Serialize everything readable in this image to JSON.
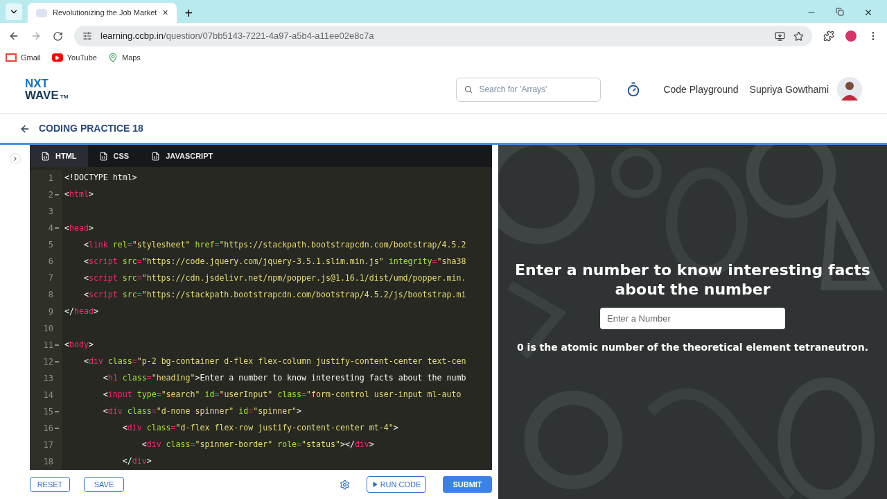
{
  "browser": {
    "tab": {
      "title": "Revolutionizing the Job Market",
      "close": "×"
    },
    "new_tab": "+",
    "url_host": "learning.ccbp.in",
    "url_path": "/question/07bb5143-7221-4a97-a5b4-a11ee02e8c7a",
    "bookmarks": [
      "Gmail",
      "YouTube",
      "Maps"
    ]
  },
  "header": {
    "logo_top": "NXT",
    "logo_bottom": "WAVE",
    "logo_tm": "TM",
    "search": {
      "placeholder": "Search for 'Arrays'"
    },
    "playground": "Code Playground",
    "user": "Supriya Gowthami"
  },
  "practice": {
    "title": "CODING PRACTICE 18"
  },
  "editor": {
    "tabs": [
      {
        "label": "HTML",
        "selected": true
      },
      {
        "label": "CSS",
        "selected": false
      },
      {
        "label": "JAVASCRIPT",
        "selected": false
      }
    ],
    "lines": [
      {
        "number": "1",
        "foldable": false,
        "tokens": [
          {
            "kind": "text",
            "text": "<!DOCTYPE html>"
          }
        ]
      },
      {
        "number": "2",
        "foldable": true,
        "tokens": [
          {
            "kind": "punct",
            "text": "<"
          },
          {
            "kind": "tag",
            "text": "html"
          },
          {
            "kind": "punct",
            "text": ">"
          }
        ]
      },
      {
        "number": "3",
        "foldable": false
      },
      {
        "number": "4",
        "foldable": true,
        "tokens": [
          {
            "kind": "punct",
            "text": "<"
          },
          {
            "kind": "tag",
            "text": "head"
          },
          {
            "kind": "punct",
            "text": ">"
          }
        ]
      },
      {
        "number": "5",
        "foldable": false,
        "tokens": [
          {
            "kind": "punct",
            "text": "    <"
          },
          {
            "kind": "tag",
            "text": "link"
          },
          {
            "kind": "attr",
            "text": " rel"
          },
          {
            "kind": "eq",
            "text": "="
          },
          {
            "kind": "string",
            "text": "\"stylesheet\""
          },
          {
            "kind": "attr",
            "text": " href"
          },
          {
            "kind": "eq",
            "text": "="
          },
          {
            "kind": "string",
            "text": "\"https://stackpath.bootstrapcdn.com/bootstrap/4.5.2"
          }
        ]
      },
      {
        "number": "6",
        "foldable": false,
        "tokens": [
          {
            "kind": "punct",
            "text": "    <"
          },
          {
            "kind": "tag",
            "text": "script"
          },
          {
            "kind": "attr",
            "text": " src"
          },
          {
            "kind": "eq",
            "text": "="
          },
          {
            "kind": "string",
            "text": "\"https://code.jquery.com/jquery-3.5.1.slim.min.js\""
          },
          {
            "kind": "attr",
            "text": " integrity"
          },
          {
            "kind": "eq",
            "text": "="
          },
          {
            "kind": "string",
            "text": "\"sha38"
          }
        ]
      },
      {
        "number": "7",
        "foldable": false,
        "tokens": [
          {
            "kind": "punct",
            "text": "    <"
          },
          {
            "kind": "tag",
            "text": "script"
          },
          {
            "kind": "attr",
            "text": " src"
          },
          {
            "kind": "eq",
            "text": "="
          },
          {
            "kind": "string",
            "text": "\"https://cdn.jsdelivr.net/npm/popper.js@1.16.1/dist/umd/popper.min."
          }
        ]
      },
      {
        "number": "8",
        "foldable": false,
        "tokens": [
          {
            "kind": "punct",
            "text": "    <"
          },
          {
            "kind": "tag",
            "text": "script"
          },
          {
            "kind": "attr",
            "text": " src"
          },
          {
            "kind": "eq",
            "text": "="
          },
          {
            "kind": "string",
            "text": "\"https://stackpath.bootstrapcdn.com/bootstrap/4.5.2/js/bootstrap.mi"
          }
        ]
      },
      {
        "number": "9",
        "foldable": false,
        "tokens": [
          {
            "kind": "punct",
            "text": "</"
          },
          {
            "kind": "tag",
            "text": "head"
          },
          {
            "kind": "punct",
            "text": ">"
          }
        ]
      },
      {
        "number": "10",
        "foldable": false
      },
      {
        "number": "11",
        "foldable": true,
        "tokens": [
          {
            "kind": "punct",
            "text": "<"
          },
          {
            "kind": "tag",
            "text": "body"
          },
          {
            "kind": "punct",
            "text": ">"
          }
        ]
      },
      {
        "number": "12",
        "foldable": true,
        "tokens": [
          {
            "kind": "punct",
            "text": "    <"
          },
          {
            "kind": "tag",
            "text": "div"
          },
          {
            "kind": "attr",
            "text": " class"
          },
          {
            "kind": "eq",
            "text": "="
          },
          {
            "kind": "string",
            "text": "\"p-2 bg-container d-flex flex-column justify-content-center text-cen"
          }
        ]
      },
      {
        "number": "13",
        "foldable": false,
        "tokens": [
          {
            "kind": "punct",
            "text": "        <"
          },
          {
            "kind": "tag",
            "text": "h1"
          },
          {
            "kind": "attr",
            "text": " class"
          },
          {
            "kind": "eq",
            "text": "="
          },
          {
            "kind": "string",
            "text": "\"heading\""
          },
          {
            "kind": "punct",
            "text": ">Enter a number to know interesting facts about the numb"
          }
        ]
      },
      {
        "number": "14",
        "foldable": false,
        "tokens": [
          {
            "kind": "punct",
            "text": "        <"
          },
          {
            "kind": "tag",
            "text": "input"
          },
          {
            "kind": "attr",
            "text": " type"
          },
          {
            "kind": "eq",
            "text": "="
          },
          {
            "kind": "string",
            "text": "\"search\""
          },
          {
            "kind": "attr",
            "text": " id"
          },
          {
            "kind": "eq",
            "text": "="
          },
          {
            "kind": "string",
            "text": "\"userInput\""
          },
          {
            "kind": "attr",
            "text": " class"
          },
          {
            "kind": "eq",
            "text": "="
          },
          {
            "kind": "string",
            "text": "\"form-control user-input ml-auto"
          }
        ]
      },
      {
        "number": "15",
        "foldable": true,
        "tokens": [
          {
            "kind": "punct",
            "text": "        <"
          },
          {
            "kind": "tag",
            "text": "div"
          },
          {
            "kind": "attr",
            "text": " class"
          },
          {
            "kind": "eq",
            "text": "="
          },
          {
            "kind": "string",
            "text": "\"d-none spinner\""
          },
          {
            "kind": "attr",
            "text": " id"
          },
          {
            "kind": "eq",
            "text": "="
          },
          {
            "kind": "string",
            "text": "\"spinner\""
          },
          {
            "kind": "punct",
            "text": ">"
          }
        ]
      },
      {
        "number": "16",
        "foldable": true,
        "tokens": [
          {
            "kind": "punct",
            "text": "            <"
          },
          {
            "kind": "tag",
            "text": "div"
          },
          {
            "kind": "attr",
            "text": " class"
          },
          {
            "kind": "eq",
            "text": "="
          },
          {
            "kind": "string",
            "text": "\"d-flex flex-row justify-content-center mt-4\""
          },
          {
            "kind": "punct",
            "text": ">"
          }
        ]
      },
      {
        "number": "17",
        "foldable": false,
        "tokens": [
          {
            "kind": "punct",
            "text": "                <"
          },
          {
            "kind": "tag",
            "text": "div"
          },
          {
            "kind": "attr",
            "text": " class"
          },
          {
            "kind": "eq",
            "text": "="
          },
          {
            "kind": "string",
            "text": "\"spinner-border\""
          },
          {
            "kind": "attr",
            "text": " role"
          },
          {
            "kind": "eq",
            "text": "="
          },
          {
            "kind": "string",
            "text": "\"status\""
          },
          {
            "kind": "punct",
            "text": "></"
          },
          {
            "kind": "tag",
            "text": "div"
          },
          {
            "kind": "punct",
            "text": ">"
          }
        ]
      },
      {
        "number": "18",
        "foldable": false,
        "tokens": [
          {
            "kind": "punct",
            "text": "            </"
          },
          {
            "kind": "tag",
            "text": "div"
          },
          {
            "kind": "punct",
            "text": ">"
          }
        ]
      }
    ],
    "buttons": {
      "reset": "RESET",
      "save": "SAVE",
      "run": "RUN CODE",
      "submit": "SUBMIT"
    }
  },
  "preview": {
    "heading": "Enter a number to know interesting facts about the number",
    "input": {
      "placeholder": "Enter a Number"
    },
    "fact": "0 is the atomic number of the theoretical element tetraneutron."
  }
}
